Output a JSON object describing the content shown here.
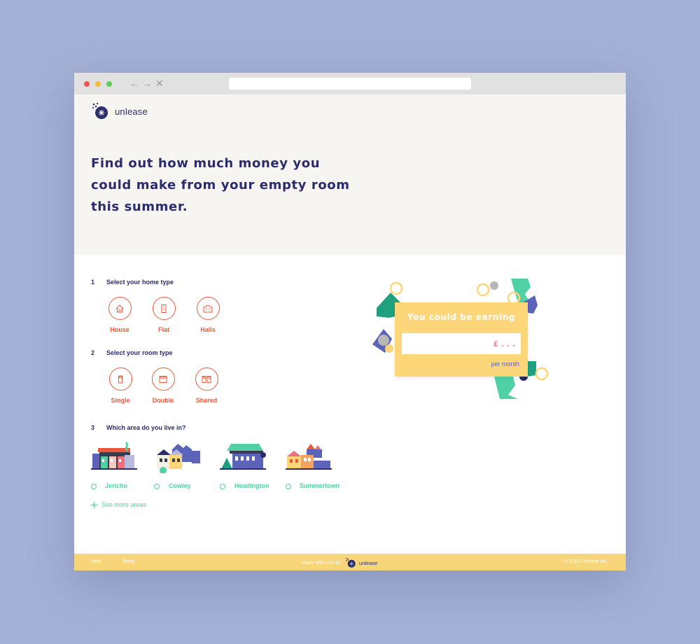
{
  "brand": {
    "name": "unlease"
  },
  "hero": {
    "headline": "Find out how much money you could make from your empty room this summer."
  },
  "steps": {
    "home": {
      "number": "1",
      "title": "Select your home type",
      "options": [
        {
          "label": "House",
          "icon": "house-icon"
        },
        {
          "label": "Flat",
          "icon": "flat-icon"
        },
        {
          "label": "Halls",
          "icon": "halls-icon"
        }
      ]
    },
    "room": {
      "number": "2",
      "title": "Select your room type",
      "options": [
        {
          "label": "Single",
          "icon": "single-bed-icon"
        },
        {
          "label": "Double",
          "icon": "double-bed-icon"
        },
        {
          "label": "Shared",
          "icon": "shared-room-icon"
        }
      ]
    },
    "area": {
      "number": "3",
      "title": "Which area do you live in?",
      "options": [
        {
          "label": "Jericho"
        },
        {
          "label": "Cowley"
        },
        {
          "label": "Headington"
        },
        {
          "label": "Summertown"
        }
      ],
      "see_more": "See more areas"
    }
  },
  "earnings": {
    "title": "You could be earning",
    "placeholder": "£ . . .",
    "per_month": "per month"
  },
  "footer": {
    "help": "Help",
    "terms": "Terms",
    "made_with": "Made with love by",
    "brand": "unlease",
    "copyright": "© 2016 Unlease Inc."
  },
  "colors": {
    "background": "#a4b0d6",
    "primary": "#2b2b6d",
    "accent_orange": "#ea5a3a",
    "accent_green": "#4fd1a5",
    "accent_yellow": "#fcd679"
  }
}
